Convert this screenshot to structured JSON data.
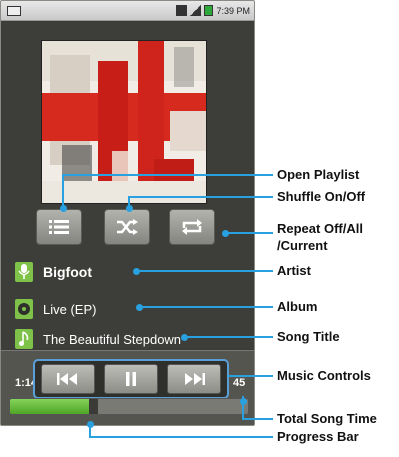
{
  "status_bar": {
    "time": "7:39 PM"
  },
  "track": {
    "artist": "Bigfoot",
    "album": "Live (EP)",
    "title": "The Beautiful Stepdown"
  },
  "progress": {
    "elapsed": "1:14",
    "total": "45",
    "fraction": 0.33
  },
  "callouts": {
    "open_playlist": "Open Playlist",
    "shuffle": "Shuffle On/Off",
    "repeat_line1": "Repeat Off/All",
    "repeat_line2": "/Current",
    "artist": "Artist",
    "album": "Album",
    "song_title": "Song Title",
    "music_controls": "Music Controls",
    "total_song_time": "Total Song Time",
    "progress_bar": "Progress Bar"
  },
  "colors": {
    "callout": "#29a0df",
    "accent_green": "#7fc24a"
  },
  "icons": {
    "playlist": "list-icon",
    "shuffle": "shuffle-icon",
    "repeat": "repeat-icon",
    "previous": "previous-track-icon",
    "pause": "pause-icon",
    "next": "next-track-icon"
  }
}
